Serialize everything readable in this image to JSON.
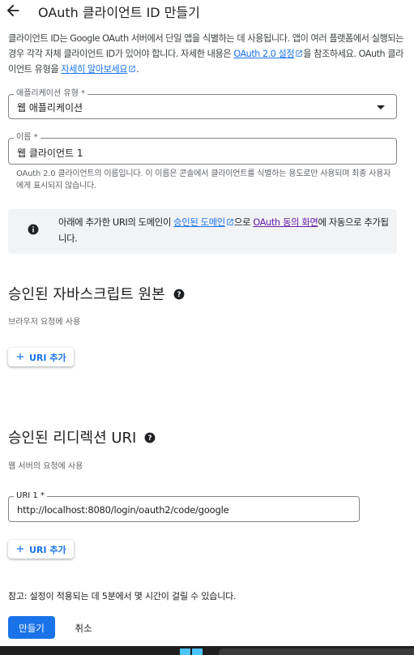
{
  "header": {
    "title": "OAuth 클라이언트 ID 만들기",
    "back_icon": "arrow-back-icon"
  },
  "intro": {
    "line1": "클라이언트 ID는 Google OAuth 서버에서 단일 앱을 식별하는 데 사용됩니다. 앱이 여러 플랫폼에서 실행되는 경우 각각 자체 클라이언트 ID가 있어야 합니다. 자세한 내용은 ",
    "settings_link": "OAuth 2.0 설정",
    "middle": "을 참조하세요. OAuth 클라이언트 유형을 ",
    "learn_more_link": "자세히 알아보세요",
    "end": "."
  },
  "app_type": {
    "label": "애플리케이션 유형 *",
    "value": "웹 애플리케이션"
  },
  "name_field": {
    "label": "이름 *",
    "value": "웹 클라이언트 1",
    "helper": "OAuth 2.0 클라이언트의 이름입니다. 이 이름은 콘솔에서 클라이언트를 식별하는 용도로만 사용되며 최종 사용자에게 표시되지 않습니다."
  },
  "banner": {
    "text_start": "아래에 추가한 URI의 도메인이 ",
    "domains_link": "승인된 도메인",
    "text_mid": "으로 ",
    "consent_link": "OAuth 동의 화면",
    "text_end": "에 자동으로 추가됩니다."
  },
  "js_origins": {
    "title": "승인된 자바스크립트 원본",
    "desc": "브라우저 요청에 사용",
    "add_label": "URI 추가"
  },
  "redirect_uris": {
    "title": "승인된 리디렉션 URI",
    "desc": "웹 서버의 요청에 사용",
    "uri1_label": "URI 1 *",
    "uri1_value": "http://localhost:8080/login/oauth2/code/google",
    "add_label": "URI 추가"
  },
  "footer": {
    "note": "참고: 설정이 적용되는 데 5분에서 몇 시간이 걸릴 수 있습니다.",
    "create_label": "만들기",
    "cancel_label": "취소"
  },
  "colors": {
    "primary": "#1a73e8",
    "visited_link": "#681da8",
    "banner_bg": "#f1f3f4",
    "text": "#202124"
  }
}
